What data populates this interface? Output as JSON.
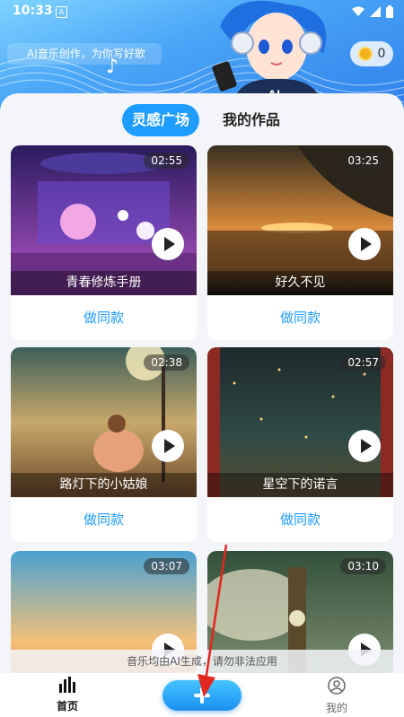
{
  "status_bar": {
    "time": "10:33",
    "notification_icon": "A"
  },
  "header": {
    "tagline": "AI音乐创作，为你写好歌",
    "coin_count": "0"
  },
  "tabs": [
    {
      "label": "灵感广场",
      "active": true
    },
    {
      "label": "我的作品",
      "active": false
    }
  ],
  "cards": [
    {
      "duration": "02:55",
      "title": "青春修炼手册",
      "action": "做同款"
    },
    {
      "duration": "03:25",
      "title": "好久不见",
      "action": "做同款"
    },
    {
      "duration": "02:38",
      "title": "路灯下的小姑娘",
      "action": "做同款"
    },
    {
      "duration": "02:57",
      "title": "星空下的诺言",
      "action": "做同款"
    },
    {
      "duration": "03:07",
      "title": "",
      "action": ""
    },
    {
      "duration": "03:10",
      "title": "",
      "action": ""
    }
  ],
  "disclaimer": "音乐均由AI生成，请勿非法应用",
  "bottom_nav": {
    "home_label": "首页",
    "me_label": "我的"
  },
  "colors": {
    "accent": "#1e9cff",
    "header": "#3f95f2"
  }
}
